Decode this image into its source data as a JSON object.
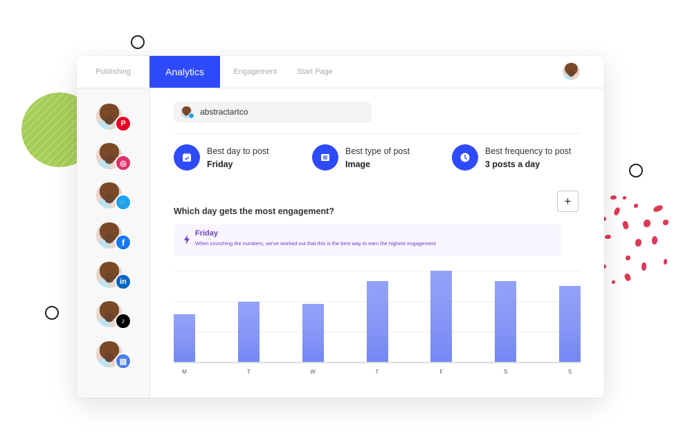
{
  "nav": {
    "tabs": [
      {
        "label": "Publishing",
        "active": false
      },
      {
        "label": "Analytics",
        "active": true
      },
      {
        "label": "Engagement",
        "active": false
      },
      {
        "label": "Start Page",
        "active": false
      }
    ]
  },
  "sidebar": {
    "accounts": [
      {
        "network": "Pinterest",
        "icon": "pinterest-icon",
        "glyph": "P",
        "color": "#e60023"
      },
      {
        "network": "Instagram",
        "icon": "instagram-icon",
        "glyph": "◎",
        "color": "#e1306c"
      },
      {
        "network": "Twitter",
        "icon": "twitter-icon",
        "glyph": "🐦",
        "color": "#1da1f2"
      },
      {
        "network": "Facebook",
        "icon": "facebook-icon",
        "glyph": "f",
        "color": "#1877f2"
      },
      {
        "network": "LinkedIn",
        "icon": "linkedin-icon",
        "glyph": "in",
        "color": "#0a66c2"
      },
      {
        "network": "TikTok",
        "icon": "tiktok-icon",
        "glyph": "♪",
        "color": "#000000"
      },
      {
        "network": "Google Business",
        "icon": "storefront-icon",
        "glyph": "▤",
        "color": "#4285f4"
      }
    ]
  },
  "account_selector": {
    "name": "abstractartco",
    "network": "Twitter"
  },
  "stats": [
    {
      "label": "Best day to post",
      "value": "Friday",
      "icon": "calendar-check-icon"
    },
    {
      "label": "Best type of post",
      "value": "Image",
      "icon": "image-post-icon"
    },
    {
      "label": "Best frequency to post",
      "value": "3 posts a day",
      "icon": "clock-icon"
    }
  ],
  "section": {
    "title": "Which day gets the most engagement?",
    "add_button": "+"
  },
  "insight": {
    "title": "Friday",
    "text": "When crunching the numbers, we've worked out that this is the best way to earn the highest engagement"
  },
  "colors": {
    "accent": "#2e4bf9",
    "bar": "#8594f6",
    "insight_text": "#6b3fc4",
    "insight_bg": "#f8f5fe"
  },
  "chart_data": {
    "type": "bar",
    "title": "Which day gets the most engagement?",
    "categories": [
      "M",
      "T",
      "W",
      "T",
      "F",
      "S",
      "S"
    ],
    "values": [
      52,
      66,
      64,
      89,
      100,
      89,
      83
    ],
    "xlabel": "",
    "ylabel": "",
    "ylim": [
      0,
      100
    ],
    "gridlines": [
      33.3,
      66.7,
      100
    ],
    "grid": true,
    "note": "relative engagement estimated from bar heights; no numeric axis shown"
  }
}
